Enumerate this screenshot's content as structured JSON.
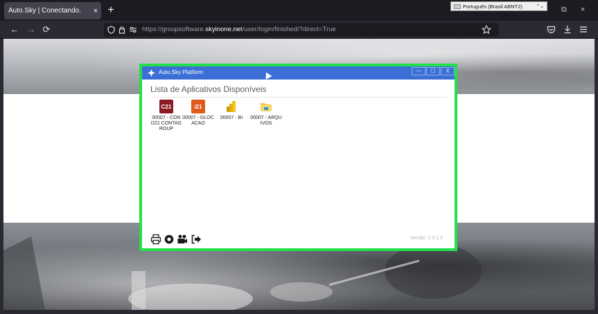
{
  "browser": {
    "tab": {
      "title": "Auto.Sky | Conectando.",
      "close": "×"
    },
    "new_tab": "+",
    "ime": {
      "label": "Português (Brasil ABNT2)",
      "arrow": "⌃⌄"
    },
    "window": {
      "restore": "⧉",
      "close": "×"
    },
    "nav": {
      "back": "←",
      "forward": "→",
      "reload": "⟳"
    },
    "url": {
      "prefix": "https://groupsoftware.",
      "domain": "skyinone.net",
      "path": "/user/login/finished/?direct=True"
    },
    "icons": [
      "shield-icon",
      "lock-icon",
      "permissions-icon",
      "bookmark-star-icon",
      "pocket-icon",
      "download-icon",
      "menu-icon"
    ]
  },
  "app": {
    "title": "Auto.Sky Platform",
    "window_buttons": {
      "minimize": "—",
      "maximize": "☐",
      "close": "X"
    },
    "heading": "Lista de Aplicativos Disponíveis",
    "items": [
      {
        "label": "00007 - COND21 CONTAGROUP",
        "icon_text": "C21",
        "color": "#8b1c24"
      },
      {
        "label": "00007 - GLOCACAO",
        "icon_text": "i21",
        "color": "#e05a1c"
      },
      {
        "label": "00007 - BI",
        "icon_text": "",
        "color": "#f2c811"
      },
      {
        "label": "00007 - ARQUIVOS",
        "icon_text": "",
        "color": "#f5c84a"
      }
    ],
    "toolbar_icons": [
      "printer-icon",
      "settings-icon",
      "camera-icon",
      "logout-icon"
    ],
    "version": "Versão: 2.0.1.9"
  },
  "colors": {
    "accent": "#3c6fd6",
    "highlight_border": "#22e04a"
  }
}
